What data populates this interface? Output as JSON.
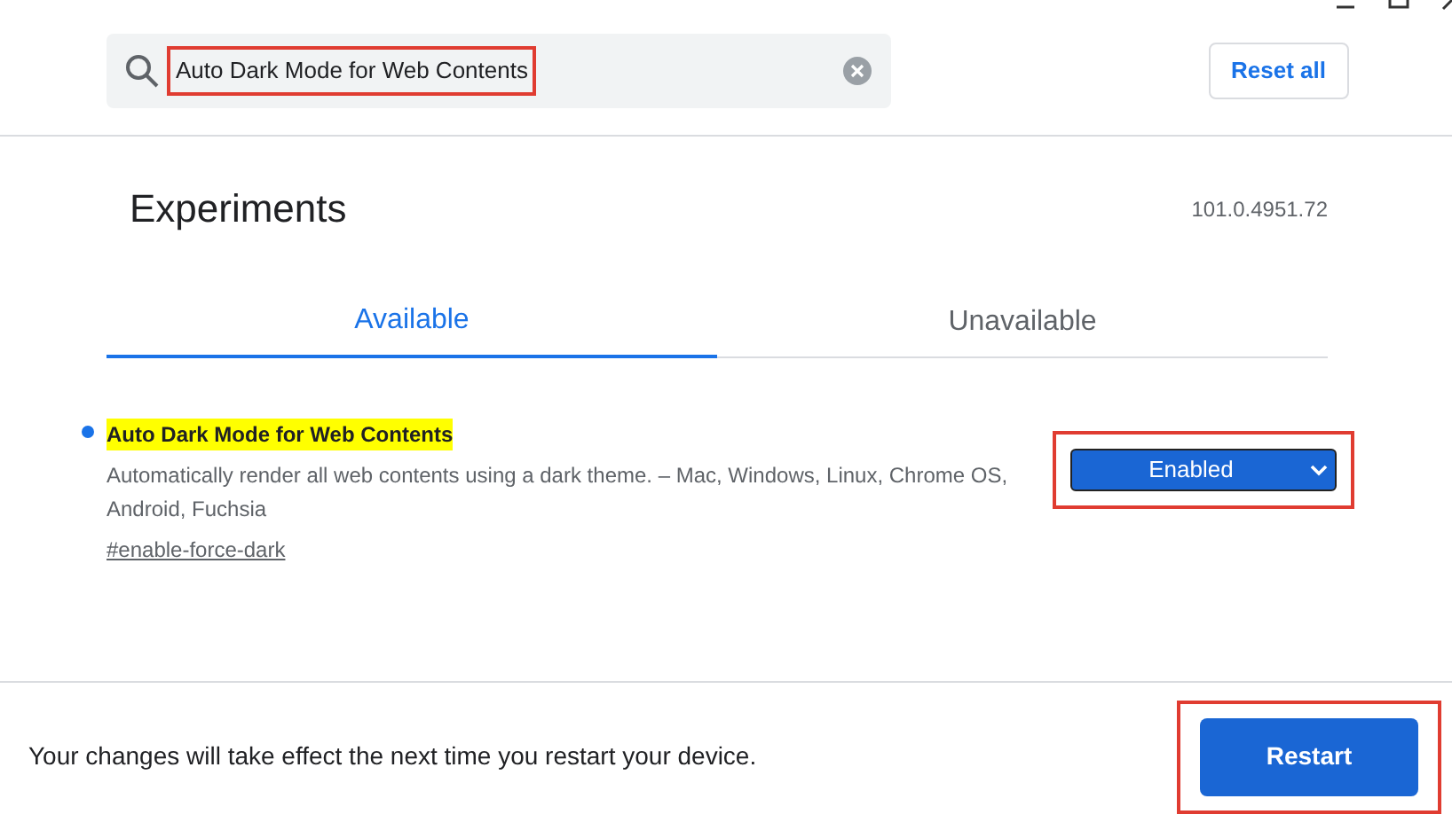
{
  "search": {
    "value": "Auto Dark Mode for Web Contents",
    "annotated": true
  },
  "reset_button": "Reset all",
  "title": "Experiments",
  "version": "101.0.4951.72",
  "tabs": [
    {
      "label": "Available",
      "selected": true
    },
    {
      "label": "Unavailable",
      "selected": false
    }
  ],
  "flags": [
    {
      "name": "Auto Dark Mode for Web Contents",
      "highlighted": true,
      "modified": true,
      "description": "Automatically render all web contents using a dark theme. – Mac, Windows, Linux, Chrome OS, Android, Fuchsia",
      "link": "#enable-force-dark",
      "value": "Enabled",
      "annotated": true
    }
  ],
  "footer": {
    "message": "Your changes will take effect the next time you restart your device.",
    "button": "Restart",
    "annotated": true
  }
}
